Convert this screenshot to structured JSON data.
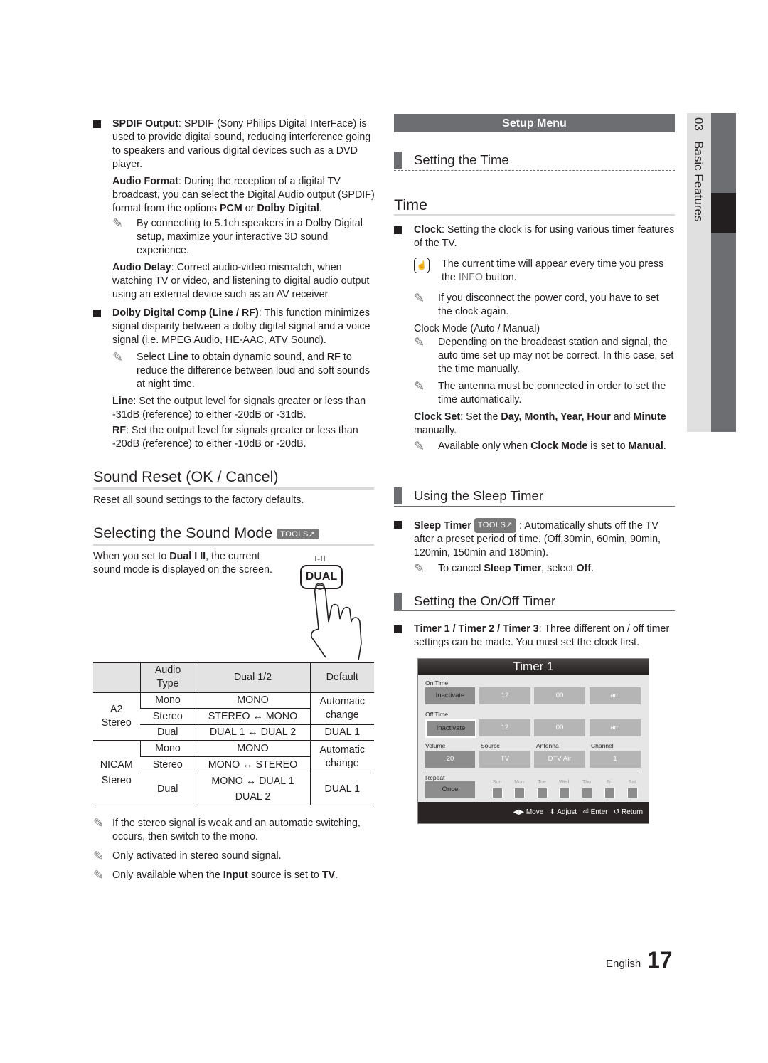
{
  "left": {
    "spdif": {
      "term": "SPDIF Output",
      "text": ": SPDIF (Sony Philips Digital InterFace) is used to provide digital sound, reducing interference going to speakers and various digital devices such as a DVD player.",
      "audio_format_term": "Audio Format",
      "audio_format_text1": ": During the reception of a digital TV broadcast, you can select the Digital Audio output (SPDIF) format from the options ",
      "audio_format_opt1": "PCM",
      "audio_format_or": " or ",
      "audio_format_opt2": "Dolby Digital",
      "audio_format_end": ".",
      "note": "By connecting to 5.1ch speakers in a Dolby Digital setup, maximize your interactive 3D sound experience.",
      "audio_delay_term": "Audio Delay",
      "audio_delay_text": ": Correct audio-video mismatch, when watching TV or video, and listening to digital audio output using an external device such as an AV receiver."
    },
    "dolby": {
      "term": "Dolby Digital Comp (Line / RF)",
      "text": ": This function minimizes signal disparity between a dolby digital signal and a voice signal (i.e. MPEG Audio, HE-AAC, ATV Sound).",
      "note_pre": "Select ",
      "note_line": "Line",
      "note_mid": " to obtain dynamic sound, and ",
      "note_rf": "RF",
      "note_post": " to reduce the difference between loud and soft sounds at night time.",
      "line_term": "Line",
      "line_text": ": Set the output level for signals greater or less than -31dB (reference) to either -20dB or -31dB.",
      "rf_term": "RF",
      "rf_text": ": Set the output level for signals greater or less than -20dB (reference) to either -10dB or -20dB."
    },
    "sound_reset": {
      "heading": "Sound Reset (OK / Cancel)",
      "text": "Reset all sound settings to the factory defaults."
    },
    "sound_mode": {
      "heading": "Selecting the Sound Mode",
      "tools_badge": "TOOLS",
      "text_pre": "When you set to ",
      "text_term": "Dual I II",
      "text_post": ", the current sound mode is displayed on the screen.",
      "remote_label": "I-II",
      "remote_button": "DUAL"
    },
    "table": {
      "headers": [
        "",
        "Audio Type",
        "Dual 1/2",
        "Default"
      ],
      "groups": [
        {
          "name": "A2 Stereo",
          "rows": [
            {
              "type": "Mono",
              "dual": "MONO"
            },
            {
              "type": "Stereo",
              "dual": "STEREO ↔ MONO"
            },
            {
              "type": "Dual",
              "dual": "DUAL 1 ↔ DUAL 2"
            }
          ],
          "default_top": "Automatic change",
          "default_dual": "DUAL 1"
        },
        {
          "name": "NICAM Stereo",
          "rows": [
            {
              "type": "Mono",
              "dual": "MONO"
            },
            {
              "type": "Stereo",
              "dual": "MONO ↔ STEREO"
            },
            {
              "type": "Dual",
              "dual": "MONO ↔ DUAL 1 DUAL 2"
            }
          ],
          "default_top": "Automatic change",
          "default_dual": "DUAL 1"
        }
      ]
    },
    "notes": [
      "If the stereo signal is weak and an automatic switching, occurs, then switch to the mono.",
      "Only activated in stereo sound signal."
    ],
    "note3_pre": "Only available when the ",
    "note3_input": "Input",
    "note3_mid": " source is set to ",
    "note3_tv": "TV",
    "note3_end": "."
  },
  "right": {
    "setup_menu": "Setup Menu",
    "setting_time_heading": "Setting the Time",
    "time_heading": "Time",
    "clock_term": "Clock",
    "clock_text": ": Setting the clock is for using various timer features of the TV.",
    "info_note_pre": "The current time will appear every time you press the ",
    "info_note_info": "INFO",
    "info_note_post": " button.",
    "power_note": "If you disconnect the power cord, you have to set the clock again.",
    "clock_mode_label": "Clock Mode (Auto / Manual)",
    "clock_mode_note1": "Depending on the broadcast station and signal, the auto time set up may not be correct. In this case, set the time manually.",
    "clock_mode_note2": "The antenna must be connected in order to set the time automatically.",
    "clock_set_term": "Clock Set",
    "clock_set_pre": ": Set the ",
    "clock_set_fields": "Day, Month, Year, Hour",
    "clock_set_and": " and ",
    "clock_set_minute": "Minute",
    "clock_set_post": " manually.",
    "clock_set_note_pre": "Available only when ",
    "clock_set_note_term": "Clock Mode",
    "clock_set_note_mid": " is set to ",
    "clock_set_note_val": "Manual",
    "clock_set_note_end": ".",
    "sleep_heading": "Using the Sleep Timer",
    "sleep_term": "Sleep Timer",
    "sleep_badge": "TOOLS",
    "sleep_text": " : Automatically shuts off the TV after a preset period of time. (Off,30min, 60min, 90min, 120min, 150min and 180min).",
    "sleep_note_pre": "To cancel ",
    "sleep_note_term": "Sleep Timer",
    "sleep_note_mid": ", select ",
    "sleep_note_val": "Off",
    "sleep_note_end": ".",
    "onoff_heading": "Setting the On/Off Timer",
    "onoff_term": "Timer 1 / Timer 2 / Timer 3",
    "onoff_text": ": Three different on / off timer settings can be made. You must set the clock first."
  },
  "osd": {
    "title": "Timer 1",
    "on_time_label": "On Time",
    "on_time": [
      "Inactivate",
      "12",
      "00",
      "am"
    ],
    "off_time_label": "Off Time",
    "off_time": [
      "Inactivate",
      "12",
      "00",
      "am"
    ],
    "volume_label": "Volume",
    "source_label": "Source",
    "antenna_label": "Antenna",
    "channel_label": "Channel",
    "volume": "20",
    "source": "TV",
    "antenna": "DTV Air",
    "channel": "1",
    "repeat_label": "Repeat",
    "repeat": "Once",
    "days": [
      "Sun",
      "Mon",
      "Tue",
      "Wed",
      "Thu",
      "Fri",
      "Sat"
    ],
    "footer": {
      "move": "Move",
      "adjust": "Adjust",
      "enter": "Enter",
      "return": "Return"
    }
  },
  "sidebar": {
    "chapter": "03",
    "title": "Basic Features"
  },
  "footer": {
    "language": "English",
    "page_number": "17"
  }
}
